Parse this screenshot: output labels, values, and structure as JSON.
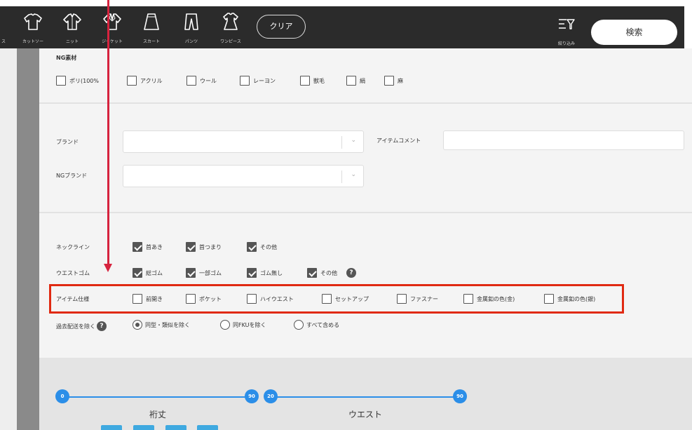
{
  "toolbar": {
    "categories": [
      {
        "label": "カットソー",
        "icon": "cut-and-sewn-icon"
      },
      {
        "label": "ニット",
        "icon": "knit-icon"
      },
      {
        "label": "ジャケット",
        "icon": "jacket-icon"
      },
      {
        "label": "スカート",
        "icon": "skirt-icon"
      },
      {
        "label": "パンツ",
        "icon": "pants-icon"
      },
      {
        "label": "ワンピース",
        "icon": "dress-icon"
      }
    ],
    "partial_label": "ス",
    "clear_label": "クリア",
    "filter_label": "絞り込み",
    "search_label": "検索"
  },
  "ng_material": {
    "title": "NG素材",
    "options": [
      {
        "label": "ポリ(100%",
        "checked": false
      },
      {
        "label": "アクリル",
        "checked": false
      },
      {
        "label": "ウール",
        "checked": false
      },
      {
        "label": "レーヨン",
        "checked": false
      },
      {
        "label": "獣毛",
        "checked": false
      },
      {
        "label": "絹",
        "checked": false
      },
      {
        "label": "麻",
        "checked": false
      }
    ]
  },
  "brand": {
    "label": "ブランド",
    "value": "",
    "item_comment_label": "アイテムコメント",
    "item_comment_value": "",
    "ng_label": "NGブランド",
    "ng_value": ""
  },
  "neckline": {
    "label": "ネックライン",
    "options": [
      {
        "label": "首あき",
        "checked": true
      },
      {
        "label": "首つまり",
        "checked": true
      },
      {
        "label": "その他",
        "checked": true
      }
    ]
  },
  "waist_rubber": {
    "label": "ウエストゴム",
    "options": [
      {
        "label": "総ゴム",
        "checked": true
      },
      {
        "label": "一部ゴム",
        "checked": true
      },
      {
        "label": "ゴム無し",
        "checked": true
      },
      {
        "label": "その他",
        "checked": true
      }
    ],
    "help_glyph": "?"
  },
  "item_spec": {
    "label": "アイテム仕様",
    "options": [
      {
        "label": "前開き",
        "checked": false
      },
      {
        "label": "ポケット",
        "checked": false
      },
      {
        "label": "ハイウエスト",
        "checked": false
      },
      {
        "label": "セットアップ",
        "checked": false
      },
      {
        "label": "ファスナー",
        "checked": false
      },
      {
        "label": "金属釦の色(金)",
        "checked": false
      },
      {
        "label": "金属釦の色(銀)",
        "checked": false
      }
    ]
  },
  "past_delivery": {
    "label": "過去配送を除く",
    "help_glyph": "?",
    "options": [
      {
        "label": "同型・類似を除く",
        "selected": true
      },
      {
        "label": "同FKUを除く",
        "selected": false
      },
      {
        "label": "すべて含める",
        "selected": false
      }
    ]
  },
  "sliders": [
    {
      "title": "裄丈",
      "min": "0",
      "max": "90"
    },
    {
      "title": "ウエスト",
      "min": "20",
      "max": "90"
    }
  ],
  "colors": {
    "toolbar": "#2b2b2b",
    "accent": "#2b8ee8",
    "highlight": "#e02a12",
    "arrow": "#d6233e"
  }
}
